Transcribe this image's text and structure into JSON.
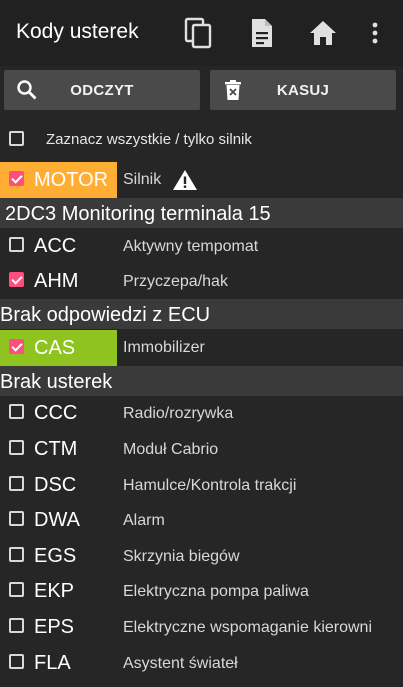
{
  "appbar": {
    "title": "Kody usterek",
    "icons": [
      "copy-icon",
      "document-icon",
      "home-icon",
      "more-vert-icon"
    ]
  },
  "toolbar": {
    "read_label": "ODCZYT",
    "read_icon": "search-icon",
    "delete_label": "KASUJ",
    "delete_icon": "trash-icon"
  },
  "select_all": {
    "label": "Zaznacz wszystkie / tylko silnik",
    "checked": false
  },
  "rows": {
    "motor": {
      "code": "MOTOR",
      "desc": "Silnik",
      "checked": true,
      "highlight": "#ffad33",
      "icon": "warning-icon"
    },
    "section1": "2DC3 Monitoring terminala 15",
    "acc": {
      "code": "ACC",
      "desc": "Aktywny tempomat",
      "checked": false
    },
    "ahm": {
      "code": "AHM",
      "desc": "Przyczepa/hak",
      "checked": true
    },
    "section2": "Brak odpowiedzi z ECU",
    "cas": {
      "code": "CAS",
      "desc": "Immobilizer",
      "checked": true,
      "highlight": "#8fc31f"
    },
    "section3": "Brak usterek",
    "ccc": {
      "code": "CCC",
      "desc": "Radio/rozrywka",
      "checked": false
    },
    "ctm": {
      "code": "CTM",
      "desc": "Moduł Cabrio",
      "checked": false
    },
    "dsc": {
      "code": "DSC",
      "desc": "Hamulce/Kontrola trakcji",
      "checked": false
    },
    "dwa": {
      "code": "DWA",
      "desc": "Alarm",
      "checked": false
    },
    "egs": {
      "code": "EGS",
      "desc": "Skrzynia biegów",
      "checked": false
    },
    "ekp": {
      "code": "EKP",
      "desc": "Elektryczna pompa paliwa",
      "checked": false
    },
    "eps": {
      "code": "EPS",
      "desc": "Elektryczne wspomaganie kierowni",
      "checked": false
    },
    "fla": {
      "code": "FLA",
      "desc": "Asystent świateł",
      "checked": false
    }
  },
  "colors": {
    "background": "#262626",
    "appbar": "#212121",
    "button": "#4a4a4a",
    "section": "#3a3a3a",
    "checkbox_checked": "#ff4d7e"
  }
}
